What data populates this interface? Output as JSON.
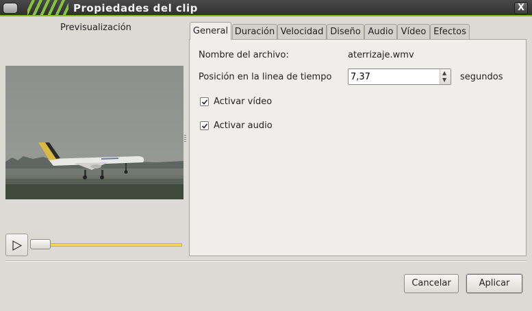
{
  "window": {
    "title": "Propiedades del clip",
    "close_glyph": "X"
  },
  "preview": {
    "label": "Previsualización",
    "image_description_icon": "airplane-landing-thumbnail"
  },
  "playback": {
    "play_icon": "play-icon",
    "position": 0.0
  },
  "tabs": [
    {
      "label": "General",
      "active": true
    },
    {
      "label": "Duración"
    },
    {
      "label": "Velocidad"
    },
    {
      "label": "Diseño"
    },
    {
      "label": "Audio"
    },
    {
      "label": "Vídeo"
    },
    {
      "label": "Efectos"
    }
  ],
  "general": {
    "filename_label": "Nombre del archivo:",
    "filename_value": "aterrizaje.wmv",
    "position_label": "Posición en la linea de tiempo",
    "position_value": "7,37",
    "position_unit": "segundos",
    "enable_video_label": "Activar vídeo",
    "enable_video_checked": true,
    "enable_audio_label": "Activar audio",
    "enable_audio_checked": true
  },
  "buttons": {
    "cancel": "Cancelar",
    "apply": "Aplicar"
  },
  "colors": {
    "titlebar_accent": "#7cc230",
    "slider_fill": "#f2d958"
  }
}
